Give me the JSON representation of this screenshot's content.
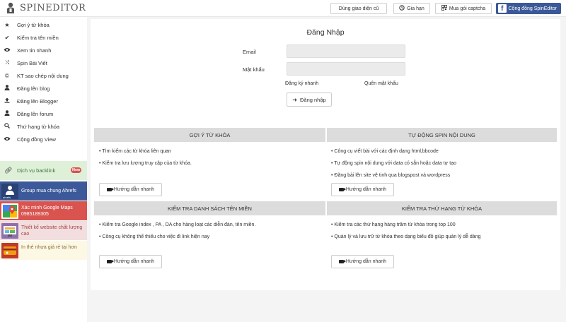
{
  "app": {
    "logo_text": "SPINEDITOR"
  },
  "topbar": {
    "old_ui": "Dùng giao diện cũ",
    "pricing": "Gia hạn",
    "captcha": "Mua gói captcha",
    "community": "Cộng đồng SpinEditor"
  },
  "sidebar": {
    "items": [
      {
        "label": "Gợi ý từ khóa",
        "icon": "star-icon"
      },
      {
        "label": "Kiểm tra tên miền",
        "icon": "check-icon"
      },
      {
        "label": "Xem tin nhanh",
        "icon": "eye-icon"
      },
      {
        "label": "Spin Bài Viết",
        "icon": "shuffle-icon"
      },
      {
        "label": "KT sao chép nội dung",
        "icon": "copyright-icon"
      },
      {
        "label": "Đăng lên blog",
        "icon": "user-icon"
      },
      {
        "label": "Đăng lên Blogger",
        "icon": "upload-icon"
      },
      {
        "label": "Đăng lên forum",
        "icon": "user-icon"
      },
      {
        "label": "Thứ hạng từ khóa",
        "icon": "search-icon"
      },
      {
        "label": "Cộng đồng View",
        "icon": "eye-icon"
      }
    ],
    "backlink": {
      "label": "Dịch vụ backlink",
      "badge": "New"
    },
    "promos": [
      {
        "text": "Group mua chung Ahrefs",
        "thumb_label": "ahrefs"
      },
      {
        "text": "Xác minh Google Maps 0985189305"
      },
      {
        "text": "Thiết kế website chất lượng cao"
      },
      {
        "text": "In thẻ nhựa giá rẻ tại hơn"
      }
    ]
  },
  "login": {
    "title": "Đăng Nhập",
    "email_label": "Email",
    "password_label": "Mật khẩu",
    "email_value": "",
    "password_value": "",
    "quick_register": "Đăng ký nhanh",
    "forgot_password": "Quên mật khẩu",
    "submit": "Đăng nhập"
  },
  "sections": [
    {
      "title": "Gợi ý từ khóa",
      "bullets": [
        "• Tìm kiếm các từ khóa liên quan",
        "• Kiểm tra lưu lượng truy cập của từ khóa."
      ],
      "guide": "Hướng dẫn nhanh"
    },
    {
      "title": "Tự động spin nội dung",
      "bullets": [
        "• Công cụ viết bài với các định dạng html,bbcode",
        "• Tự động spin nội dung với data có sẵn hoặc data tự tạo",
        "• Đăng bài lên site vệ tinh qua blogspost và wordpress"
      ],
      "guide": "Hướng dẫn nhanh"
    },
    {
      "title": "Kiểm tra danh sách tên miền",
      "bullets": [
        "• Kiểm tra Google index , PA , DA cho hàng loạt các diễn đàn, tên miền.",
        "• Công cụ không thể thiếu cho việc đi link hiện nay"
      ],
      "guide": "Hướng dẫn nhanh"
    },
    {
      "title": "Kiểm tra thứ hạng từ khóa",
      "bullets": [
        "• Kiểm tra các thứ hạng hàng trăm từ khóa trong top 100",
        "• Quản lý và lưu trữ từ khóa theo dạng biểu đồ giúp quản lý dễ dàng"
      ],
      "guide": "Hướng dẫn nhanh"
    }
  ],
  "colors": {
    "facebook": "#3b5998",
    "backlink_bg": "#dff0d8",
    "ahrefs_bg": "#3c5a99",
    "maps_bg": "#d9534f",
    "website_bg": "#f2dede",
    "print_bg": "#fcf8e3",
    "section_header_bg": "#dcdcdc"
  }
}
